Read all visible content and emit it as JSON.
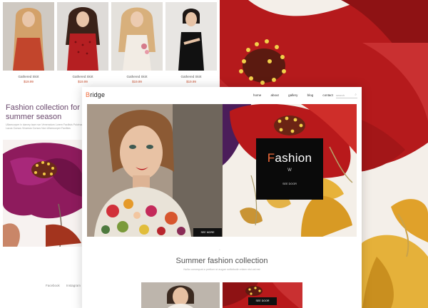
{
  "colors": {
    "accent": "#f06a3a",
    "floral_red": "#b8191b",
    "floral_magenta": "#8f1a5e",
    "black_box": "#0a0a0a"
  },
  "back_site": {
    "products": [
      {
        "name": "Gathered Skirt",
        "price": "$19.99"
      },
      {
        "name": "Gathered Skirt",
        "price": "$19.99"
      },
      {
        "name": "Gathered Skirt",
        "price": "$19.99"
      },
      {
        "name": "Gathered Skirt",
        "price": "$19.99"
      }
    ],
    "title_line1": "Fashion collection for",
    "title_line2": "summer season",
    "body_text": "Ullamcorper iv darvey tace non Venenatum Lorem Facilisis Pulvinar Lacus Cursus Vivamus Cursus Non Ullamcorper Facilisis",
    "footer_links": [
      "Facebook",
      "Instagram"
    ]
  },
  "front_site": {
    "logo_first": "B",
    "logo_rest": "ridge",
    "menu": [
      "home",
      "about",
      "gallery",
      "blog",
      "contact"
    ],
    "search_placeholder": "search",
    "hero_card": {
      "title_first": "F",
      "title_rest": "ashion",
      "separator": "W",
      "button": "SEE DOOR"
    },
    "hero_button": "SEE MORE",
    "section_title": "Summer fashion collection",
    "section_subtitle": "Nulla consequat a pretium si augue sollicitudin etiam nisi val est",
    "thumb_button": "SEE DOOR"
  }
}
